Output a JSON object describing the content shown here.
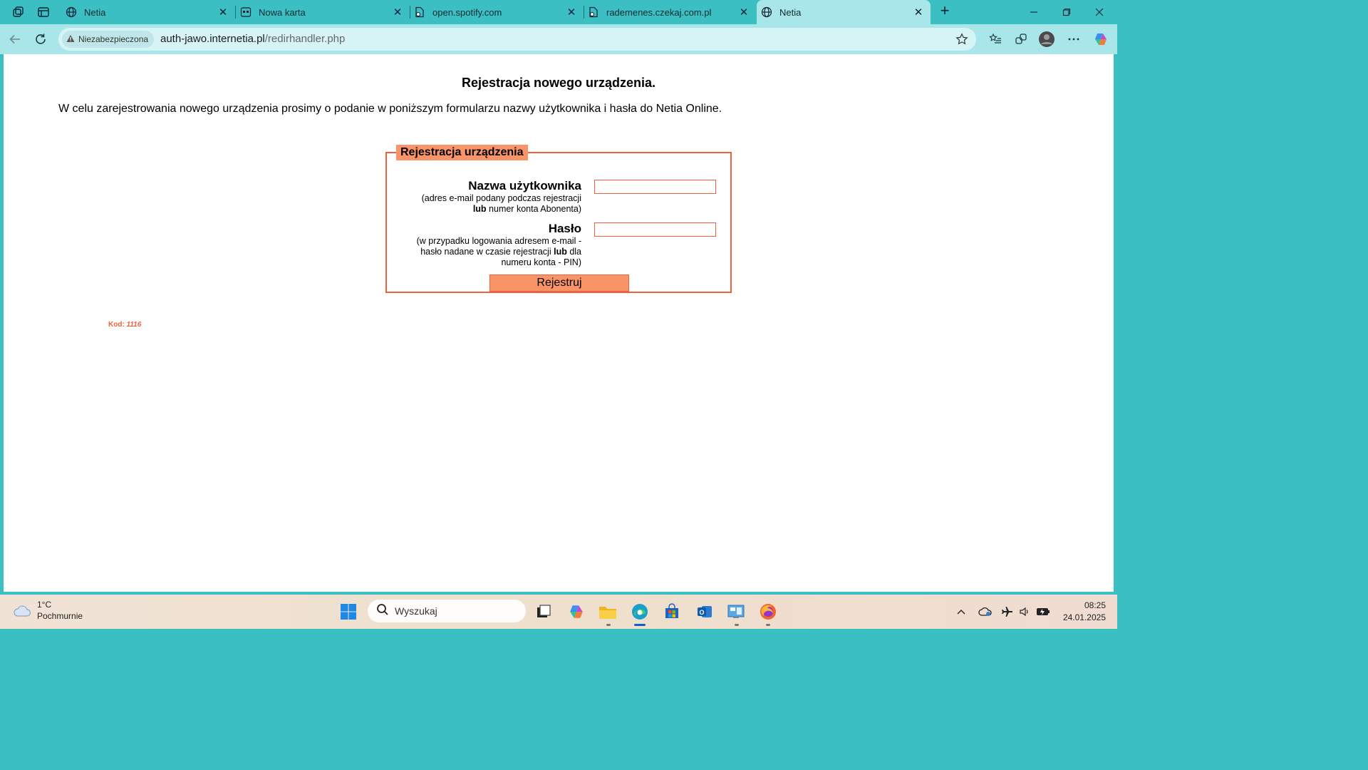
{
  "browser": {
    "tabs": [
      {
        "title": "Netia",
        "icon": "globe-icon",
        "active": false
      },
      {
        "title": "Nowa karta",
        "icon": "new-tab-page-icon",
        "active": false
      },
      {
        "title": "open.spotify.com",
        "icon": "document-icon",
        "active": false
      },
      {
        "title": "rademenes.czekaj.com.pl",
        "icon": "document-icon",
        "active": false
      },
      {
        "title": "Netia",
        "icon": "globe-icon",
        "active": true
      }
    ],
    "security_label": "Niezabezpieczona",
    "url_host": "auth-jawo.internetia.pl",
    "url_path": "/redirhandler.php",
    "accent_color": "#3bbfc3"
  },
  "page": {
    "heading": "Rejestracja nowego urządzenia.",
    "intro": "W celu zarejestrowania nowego urządzenia prosimy o podanie w poniższym formularzu nazwy użytkownika i hasła do Netia Online.",
    "form": {
      "legend": "Rejestracja urządzenia",
      "username_label": "Nazwa użytkownika",
      "username_hint_1": "(adres e-mail podany podczas rejestracji",
      "username_hint_2_bold": "lub",
      "username_hint_2_rest": " numer konta Abonenta)",
      "username_value": "",
      "password_label": "Hasło",
      "password_hint_1": "(w przypadku logowania adresem e-mail -",
      "password_hint_2_pre": "hasło nadane w czasie rejestracji ",
      "password_hint_2_bold": "lub",
      "password_hint_2_post": " dla",
      "password_hint_3": "numeru konta - PIN)",
      "password_value": "",
      "submit_label": "Rejestruj"
    },
    "kod_label": "Kod: ",
    "kod_value": "1116",
    "form_color": "#f0603a",
    "form_fill": "#f99468"
  },
  "taskbar": {
    "temperature": "1°C",
    "condition": "Pochmurnie",
    "search_placeholder": "Wyszukaj",
    "time": "08:25",
    "date": "24.01.2025"
  }
}
